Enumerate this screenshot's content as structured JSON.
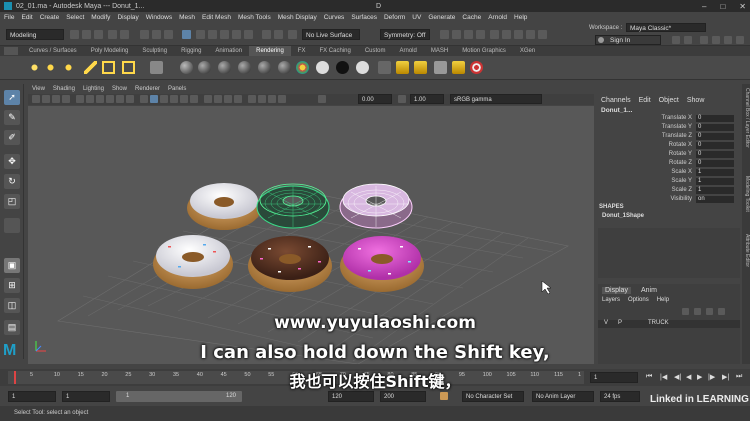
{
  "titlebar": {
    "title": "02_01.ma - Autodesk Maya --- Donut_1...",
    "center": "D"
  },
  "menu": [
    "File",
    "Edit",
    "Create",
    "Select",
    "Modify",
    "Display",
    "Windows",
    "Mesh",
    "Edit Mesh",
    "Mesh Tools",
    "Mesh Display",
    "Curves",
    "Surfaces",
    "Deform",
    "UV",
    "Generate",
    "Cache",
    "Arnold",
    "Help"
  ],
  "status": {
    "mode": "Modeling",
    "live_surface": "No Live Surface",
    "symmetry": "Symmetry: Off",
    "workspace_label": "Workspace :",
    "workspace": "Maya Classic*",
    "sign_in": "Sign In"
  },
  "shelf_tabs": [
    "Curves / Surfaces",
    "Poly Modeling",
    "Sculpting",
    "Rigging",
    "Animation",
    "Rendering",
    "FX",
    "FX Caching",
    "Custom",
    "Arnold",
    "MASH",
    "Motion Graphics",
    "XGen"
  ],
  "shelf_active": "Rendering",
  "viewport": {
    "menu": [
      "View",
      "Shading",
      "Lighting",
      "Show",
      "Renderer",
      "Panels"
    ],
    "exposure": "0.00",
    "gamma": "1.00",
    "colorspace": "sRGB gamma"
  },
  "channel_box": {
    "tabs": [
      "Channels",
      "Edit",
      "Object",
      "Show"
    ],
    "object": "Donut_1...",
    "attrs": [
      {
        "label": "Translate X",
        "value": "0"
      },
      {
        "label": "Translate Y",
        "value": "0"
      },
      {
        "label": "Translate Z",
        "value": "0"
      },
      {
        "label": "Rotate X",
        "value": "0"
      },
      {
        "label": "Rotate Y",
        "value": "0"
      },
      {
        "label": "Rotate Z",
        "value": "0"
      },
      {
        "label": "Scale X",
        "value": "1"
      },
      {
        "label": "Scale Y",
        "value": "1"
      },
      {
        "label": "Scale Z",
        "value": "1"
      },
      {
        "label": "Visibility",
        "value": "on"
      }
    ],
    "shapes_label": "SHAPES",
    "shape": "Donut_1Shape",
    "layer_tabs": [
      "Display",
      "Anim"
    ],
    "layer_menu": [
      "Layers",
      "Options",
      "Help"
    ],
    "layer": {
      "v": "V",
      "p": "P",
      "name": "TRUCK"
    }
  },
  "side_tabs": [
    "Channel Box / Layer Editor",
    "Modeling Toolkit",
    "Attribute Editor"
  ],
  "timeline": {
    "ticks": [
      "5",
      "10",
      "15",
      "20",
      "25",
      "30",
      "35",
      "40",
      "45",
      "50",
      "55",
      "60",
      "65",
      "70",
      "75",
      "80",
      "85",
      "90",
      "95",
      "100",
      "105",
      "110",
      "115",
      "1"
    ],
    "current": "1"
  },
  "range": {
    "start": "1",
    "start2": "1",
    "inner_start": "1",
    "inner_end": "120",
    "end": "120",
    "end2": "200",
    "character_set": "No Character Set",
    "anim_layer": "No Anim Layer",
    "fps": "24 fps"
  },
  "help": "Select Tool: select an object",
  "subtitles": {
    "url": "www.yuyulaoshi.com",
    "en": "I can also hold down the Shift key,",
    "zh": "我也可以按住Shift键，"
  },
  "watermark": "Linked in LEARNING"
}
